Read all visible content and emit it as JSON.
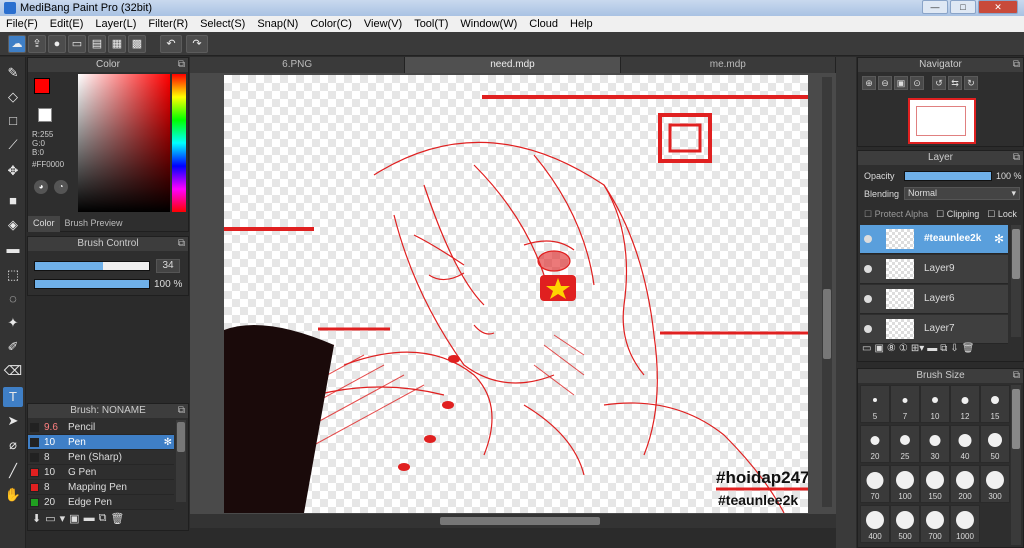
{
  "window": {
    "title": "MediBang Paint Pro (32bit)",
    "minimize": "—",
    "maximize": "□",
    "close": "✕"
  },
  "menu": [
    "File(F)",
    "Edit(E)",
    "Layer(L)",
    "Filter(R)",
    "Select(S)",
    "Snap(N)",
    "Color(C)",
    "View(V)",
    "Tool(T)",
    "Window(W)",
    "Cloud",
    "Help"
  ],
  "toolbar": {
    "icons": [
      "cloud-icon",
      "export-icon",
      "comment-icon",
      "chat-icon",
      "page-icon",
      "grid-icon",
      "tiles-icon",
      "undo-icon",
      "redo-icon"
    ],
    "undo": "↶",
    "redo": "↷"
  },
  "tools": [
    "brush-icon",
    "eraser-icon",
    "rectangle-icon",
    "pen-line-icon",
    "move-icon",
    "fill-rect-icon",
    "bucket-icon",
    "gradient-icon",
    "select-rect-icon",
    "lasso-icon",
    "magic-wand-icon",
    "select-pen-icon",
    "select-eraser-icon",
    "text-icon",
    "operation-icon",
    "eyedropper-icon",
    "dropper-icon",
    "hand-icon"
  ],
  "color": {
    "title": "Color",
    "main_color": "#FF0000",
    "r": "R:255",
    "g": "G:0",
    "b": "B:0",
    "hex": "#FF0000",
    "tab_color": "Color",
    "tab_preview": "Brush Preview"
  },
  "brush_control": {
    "title": "Brush Control",
    "size": "34",
    "size_fraction": 0.6,
    "opacity": "100 %",
    "opacity_fraction": 1.0
  },
  "brush_list": {
    "title": "Brush: NONAME",
    "items": [
      {
        "size": "9.6",
        "name": "Pencil",
        "swatch": "#222222",
        "active": false
      },
      {
        "size": "10",
        "name": "Pen",
        "swatch": "#222222",
        "active": true
      },
      {
        "size": "8",
        "name": "Pen (Sharp)",
        "swatch": "#222222",
        "active": false
      },
      {
        "size": "10",
        "name": "G Pen",
        "swatch": "#e02020",
        "active": false
      },
      {
        "size": "8",
        "name": "Mapping Pen",
        "swatch": "#e02020",
        "active": false
      },
      {
        "size": "20",
        "name": "Edge Pen",
        "swatch": "#20a020",
        "active": false
      }
    ]
  },
  "tabs": [
    "6.PNG",
    "need.mdp",
    "me.mdp"
  ],
  "canvas_text": {
    "tag1": "#hoidap247",
    "tag2": "#teaunlee2k"
  },
  "navigator": {
    "title": "Navigator"
  },
  "layer": {
    "title": "Layer",
    "opacity_label": "Opacity",
    "opacity_value": "100 %",
    "opacity_fraction": 1.0,
    "blending_label": "Blending",
    "blending_value": "Normal",
    "protect_alpha": "Protect Alpha",
    "clipping": "Clipping",
    "lock": "Lock",
    "layers": [
      {
        "name": "#teaunlee2k",
        "active": true
      },
      {
        "name": "Layer9",
        "active": false
      },
      {
        "name": "Layer6",
        "active": false
      },
      {
        "name": "Layer7",
        "active": false
      }
    ]
  },
  "brush_size": {
    "title": "Brush Size",
    "sizes": [
      "5",
      "7",
      "10",
      "12",
      "15",
      "20",
      "25",
      "30",
      "40",
      "50",
      "70",
      "100",
      "150",
      "200",
      "300",
      "400",
      "500",
      "700",
      "1000"
    ]
  },
  "colors": {
    "accent": "#3f7fc6",
    "canvas_red": "#e02020"
  }
}
